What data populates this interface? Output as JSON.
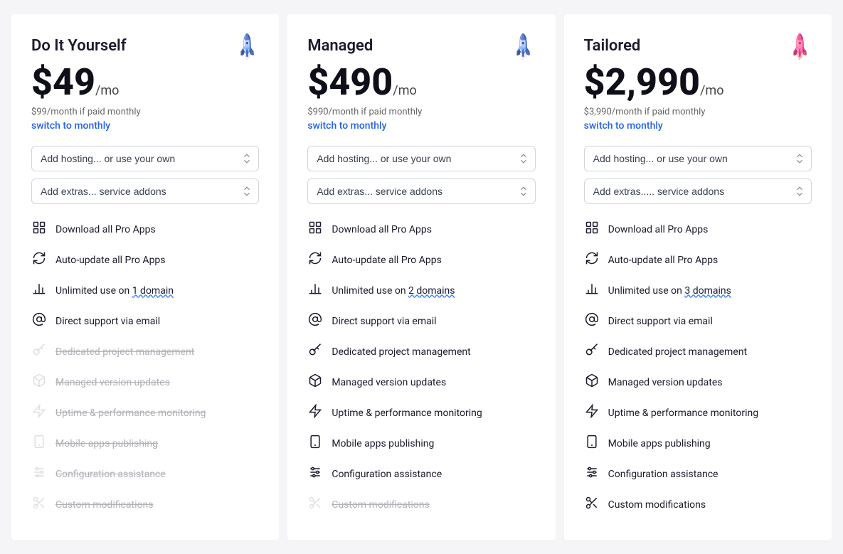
{
  "plans": [
    {
      "id": "diy",
      "name": "Do It Yourself",
      "icon": "🚀",
      "iconClass": "blue",
      "price": "$49",
      "period": "/mo",
      "monthlyNote": "$99/month if paid monthly",
      "switchLabel": "switch to monthly",
      "hosting_placeholder": "Add hosting...",
      "hosting_sub": "or use your own",
      "extras_placeholder": "Add extras...",
      "extras_sub": "service addons",
      "features": [
        {
          "icon": "grid",
          "text": "Download all Pro Apps",
          "disabled": false
        },
        {
          "icon": "refresh",
          "text": "Auto-update all Pro Apps",
          "disabled": false
        },
        {
          "icon": "chart",
          "text": "Unlimited use on 1 domain",
          "disabled": false,
          "domain": true
        },
        {
          "icon": "at",
          "text": "Direct support via email",
          "disabled": false
        },
        {
          "icon": "key",
          "text": "Dedicated project management",
          "disabled": true
        },
        {
          "icon": "box",
          "text": "Managed version updates",
          "disabled": true
        },
        {
          "icon": "bolt",
          "text": "Uptime & performance monitoring",
          "disabled": true
        },
        {
          "icon": "mobile",
          "text": "Mobile apps publishing",
          "disabled": true
        },
        {
          "icon": "sliders",
          "text": "Configuration assistance",
          "disabled": true
        },
        {
          "icon": "scissors",
          "text": "Custom modifications",
          "disabled": true
        }
      ]
    },
    {
      "id": "managed",
      "name": "Managed",
      "icon": "🚀",
      "iconClass": "blue",
      "price": "$490",
      "period": "/mo",
      "monthlyNote": "$990/month if paid monthly",
      "switchLabel": "switch to monthly",
      "hosting_placeholder": "Add hosting...",
      "hosting_sub": "or use your own",
      "extras_placeholder": "Add extras...",
      "extras_sub": "service addons",
      "features": [
        {
          "icon": "grid",
          "text": "Download all Pro Apps",
          "disabled": false
        },
        {
          "icon": "refresh",
          "text": "Auto-update all Pro Apps",
          "disabled": false
        },
        {
          "icon": "chart",
          "text": "Unlimited use on 2 domains",
          "disabled": false,
          "domain": true
        },
        {
          "icon": "at",
          "text": "Direct support via email",
          "disabled": false
        },
        {
          "icon": "key",
          "text": "Dedicated project management",
          "disabled": false
        },
        {
          "icon": "box",
          "text": "Managed version updates",
          "disabled": false
        },
        {
          "icon": "bolt",
          "text": "Uptime & performance monitoring",
          "disabled": false
        },
        {
          "icon": "mobile",
          "text": "Mobile apps publishing",
          "disabled": false
        },
        {
          "icon": "sliders",
          "text": "Configuration assistance",
          "disabled": false
        },
        {
          "icon": "scissors",
          "text": "Custom modifications",
          "disabled": true
        }
      ]
    },
    {
      "id": "tailored",
      "name": "Tailored",
      "icon": "🚀",
      "iconClass": "pink",
      "price": "$2,990",
      "period": "/mo",
      "monthlyNote": "$3,990/month if paid monthly",
      "switchLabel": "switch to monthly",
      "hosting_placeholder": "Add hosting...",
      "hosting_sub": "or use your own",
      "extras_placeholder": "Add extras.....",
      "extras_sub": "service addons",
      "features": [
        {
          "icon": "grid",
          "text": "Download all Pro Apps",
          "disabled": false
        },
        {
          "icon": "refresh",
          "text": "Auto-update all Pro Apps",
          "disabled": false
        },
        {
          "icon": "chart",
          "text": "Unlimited use on 3 domains",
          "disabled": false,
          "domain": true
        },
        {
          "icon": "at",
          "text": "Direct support via email",
          "disabled": false
        },
        {
          "icon": "key",
          "text": "Dedicated project management",
          "disabled": false
        },
        {
          "icon": "box",
          "text": "Managed version updates",
          "disabled": false
        },
        {
          "icon": "bolt",
          "text": "Uptime & performance monitoring",
          "disabled": false
        },
        {
          "icon": "mobile",
          "text": "Mobile apps publishing",
          "disabled": false
        },
        {
          "icon": "sliders",
          "text": "Configuration assistance",
          "disabled": false
        },
        {
          "icon": "scissors",
          "text": "Custom modifications",
          "disabled": false
        }
      ]
    }
  ]
}
